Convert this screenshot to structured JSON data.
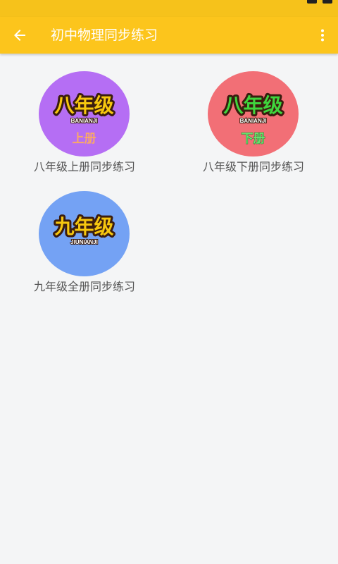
{
  "app_bar": {
    "title": "初中物理同步练习",
    "back_icon": "arrow-left-icon",
    "overflow_icon": "more-vertical-icon",
    "background_color": "#fcc51c"
  },
  "grades": [
    {
      "label": "八年级上册同步练习",
      "badge_title": "八年级",
      "badge_pinyin": "BANIANJI",
      "badge_volume": "上册",
      "circle_color": "#b56ef4",
      "title_color": "#f6c70f",
      "volume_color": "#f9a869"
    },
    {
      "label": "八年级下册同步练习",
      "badge_title": "八年级",
      "badge_pinyin": "BANIANJI",
      "badge_volume": "下册",
      "circle_color": "#f26f76",
      "title_color": "#3fd53d",
      "volume_color": "#69e36e"
    },
    {
      "label": "九年级全册同步练习",
      "badge_title": "九年级",
      "badge_pinyin": "JIUNIANJI",
      "badge_volume": "",
      "circle_color": "#74a2f4",
      "title_color": "#f6c70f",
      "volume_color": "#f6c70f"
    }
  ]
}
